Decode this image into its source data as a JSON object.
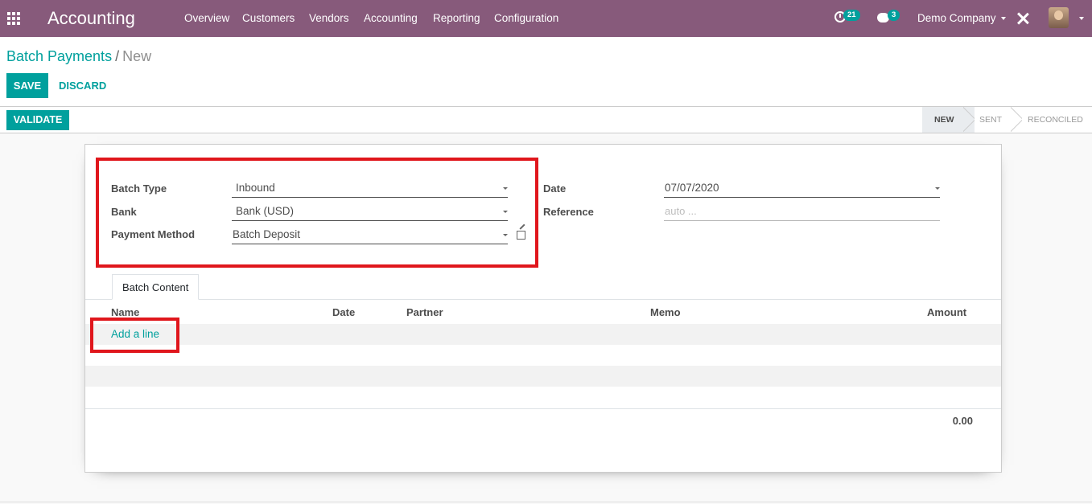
{
  "navbar": {
    "app_title": "Accounting",
    "menu": [
      "Overview",
      "Customers",
      "Vendors",
      "Accounting",
      "Reporting",
      "Configuration"
    ],
    "activity_count": "21",
    "message_count": "3",
    "company": "Demo Company"
  },
  "breadcrumb": {
    "parent": "Batch Payments",
    "separator": "/",
    "current": "New"
  },
  "buttons": {
    "save": "SAVE",
    "discard": "DISCARD",
    "validate": "VALIDATE"
  },
  "statusbar": {
    "stages": [
      "NEW",
      "SENT",
      "RECONCILED"
    ],
    "active_stage": "NEW"
  },
  "form": {
    "batch_type_label": "Batch Type",
    "batch_type_value": "Inbound",
    "bank_label": "Bank",
    "bank_value": "Bank (USD)",
    "payment_method_label": "Payment Method",
    "payment_method_value": "Batch Deposit",
    "date_label": "Date",
    "date_value": "07/07/2020",
    "reference_label": "Reference",
    "reference_placeholder": "auto ..."
  },
  "tabs": {
    "batch_content": "Batch Content"
  },
  "table": {
    "columns": [
      "Name",
      "Date",
      "Partner",
      "Memo",
      "Amount"
    ],
    "add_line": "Add a line",
    "total": "0.00"
  },
  "colors": {
    "navbar": "#875a7b",
    "primary": "#00a09d",
    "highlight": "#e0161c"
  }
}
